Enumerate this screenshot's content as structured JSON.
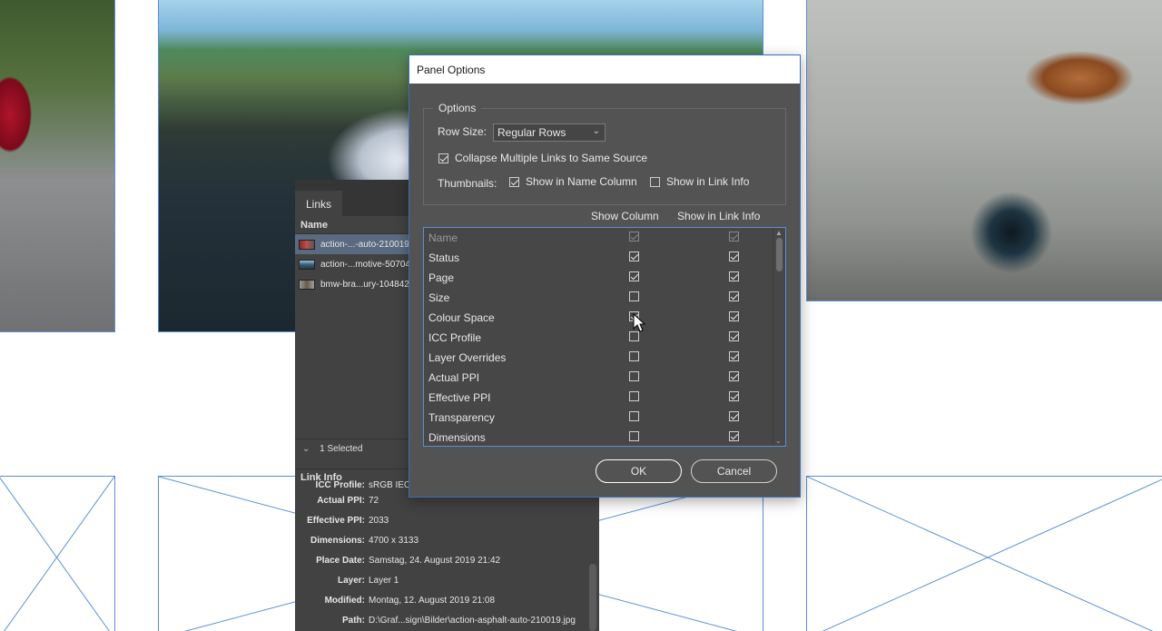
{
  "links_panel": {
    "tab": "Links",
    "column_header": "Name",
    "rows": [
      {
        "name": "action-...-auto-210019.",
        "selected": true
      },
      {
        "name": "action-...motive-50704.",
        "selected": false
      },
      {
        "name": "bmw-bra...ury-104842",
        "selected": false
      }
    ],
    "status": "1 Selected",
    "link_info_header": "Link Info",
    "link_info": [
      {
        "label": "ICC Profile:",
        "value": "sRGB IEC..."
      },
      {
        "label": "Actual PPI:",
        "value": "72"
      },
      {
        "label": "Effective PPI:",
        "value": "2033"
      },
      {
        "label": "Dimensions:",
        "value": "4700 x 3133"
      },
      {
        "label": "Place Date:",
        "value": "Samstag, 24. August 2019 21:42"
      },
      {
        "label": "Layer:",
        "value": "Layer 1"
      },
      {
        "label": "Modified:",
        "value": "Montag, 12. August 2019 21:08"
      },
      {
        "label": "Path:",
        "value": "D:\\Graf...sign\\Bilder\\action-asphalt-auto-210019.jpg"
      }
    ]
  },
  "dialog": {
    "title": "Panel Options",
    "options_legend": "Options",
    "row_size_label": "Row Size:",
    "row_size_value": "Regular Rows",
    "collapse_label": "Collapse Multiple Links to Same Source",
    "collapse_checked": true,
    "thumbnails_label": "Thumbnails:",
    "thumb_name_label": "Show in Name Column",
    "thumb_name_checked": true,
    "thumb_info_label": "Show in Link Info",
    "thumb_info_checked": false,
    "col_header_show": "Show Column",
    "col_header_info": "Show in Link Info",
    "rows": [
      {
        "label": "Name",
        "show": true,
        "info": true,
        "disabled": true
      },
      {
        "label": "Status",
        "show": true,
        "info": true,
        "disabled": false
      },
      {
        "label": "Page",
        "show": true,
        "info": true,
        "disabled": false
      },
      {
        "label": "Size",
        "show": false,
        "info": true,
        "disabled": false
      },
      {
        "label": "Colour Space",
        "show": true,
        "info": true,
        "disabled": false
      },
      {
        "label": "ICC Profile",
        "show": false,
        "info": true,
        "disabled": false
      },
      {
        "label": "Layer Overrides",
        "show": false,
        "info": true,
        "disabled": false
      },
      {
        "label": "Actual PPI",
        "show": false,
        "info": true,
        "disabled": false
      },
      {
        "label": "Effective PPI",
        "show": false,
        "info": true,
        "disabled": false
      },
      {
        "label": "Transparency",
        "show": false,
        "info": true,
        "disabled": false
      },
      {
        "label": "Dimensions",
        "show": false,
        "info": true,
        "disabled": false
      }
    ],
    "ok_label": "OK",
    "cancel_label": "Cancel"
  },
  "icons": {
    "chevron": "chevron-down-icon",
    "cursor": "mouse-pointer-icon"
  },
  "colors": {
    "frame_edge": "#5b8fd6",
    "panel_bg": "#424242",
    "dialog_bg": "#535353",
    "selection": "#5a6a80"
  }
}
